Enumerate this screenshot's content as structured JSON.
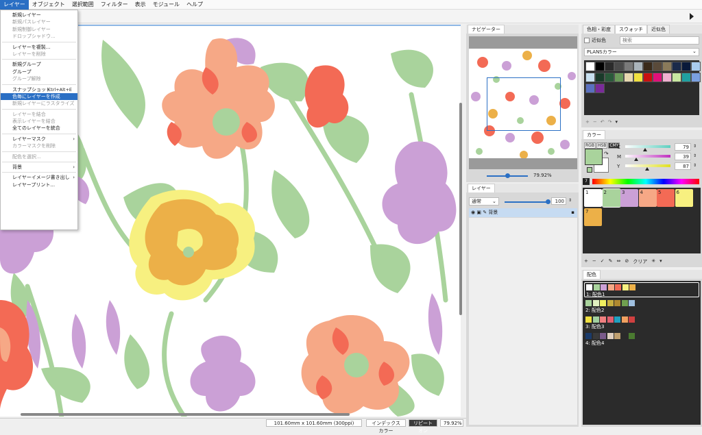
{
  "menubar": [
    "レイヤー",
    "オブジェクト",
    "選択範囲",
    "フィルター",
    "表示",
    "モジュール",
    "ヘルプ"
  ],
  "layer_menu": [
    {
      "label": "新規レイヤー",
      "dis": false
    },
    {
      "label": "新規パスレイヤー",
      "dis": true
    },
    {
      "label": "新規制御レイヤー",
      "dis": true
    },
    {
      "label": "ドロップシャドウ...",
      "dis": true
    },
    {
      "sep": true
    },
    {
      "label": "レイヤーを複製...",
      "dis": false
    },
    {
      "label": "レイヤーを削除",
      "dis": true
    },
    {
      "sep": true
    },
    {
      "label": "新規グループ",
      "dis": false
    },
    {
      "label": "グループ",
      "dis": false
    },
    {
      "label": "グループ解除",
      "dis": true
    },
    {
      "sep": true
    },
    {
      "label": "スナップショット",
      "dis": false,
      "shortcut": "Ctrl+Alt+E"
    },
    {
      "label": "色毎にレイヤーを作成",
      "dis": false,
      "hl": true
    },
    {
      "label": "新規レイヤーにラスタライズ",
      "dis": true
    },
    {
      "sep": true
    },
    {
      "label": "レイヤーを結合",
      "dis": true
    },
    {
      "label": "表示レイヤーを結合",
      "dis": true
    },
    {
      "label": "全てのレイヤーを統合",
      "dis": false
    },
    {
      "sep": true
    },
    {
      "label": "レイヤーマスク",
      "dis": false,
      "sub": true
    },
    {
      "label": "カラーマスクを削除",
      "dis": true
    },
    {
      "sep": true
    },
    {
      "label": "配色を選択...",
      "dis": true
    },
    {
      "sep": true
    },
    {
      "label": "背景",
      "dis": false,
      "sub": true
    },
    {
      "sep": true
    },
    {
      "label": "レイヤーイメージ書き出し",
      "dis": false,
      "sub": true
    },
    {
      "label": "レイヤープリント...",
      "dis": false
    }
  ],
  "status": {
    "size": "101.60mm x 101.60mm (300ppi)",
    "mode": "インデックスカラー",
    "repeat": "リピートオン",
    "zoom": "79.92%"
  },
  "navigator": {
    "title": "ナビゲーター",
    "zoom": "79.92%"
  },
  "layers": {
    "title": "レイヤー",
    "blend": "通常",
    "opacity": "100",
    "layer_name": "背景"
  },
  "swatch_panel": {
    "tabs": [
      "色相・彩度",
      "スウォッチ",
      "近似色"
    ],
    "approx_label": "近似色",
    "search_placeholder": "検索",
    "set": "PLANSカラー",
    "colors": [
      "#ffffff",
      "#000000",
      "#2b2b2b",
      "#4a4a4a",
      "#7a7a7a",
      "#aab4bb",
      "#3a2a1a",
      "#5a4a3a",
      "#8a7a5a",
      "#1a2a4a",
      "#0a1a3a",
      "#aaccee",
      "#c8e0f0",
      "#1a3a2a",
      "#2a5a3a",
      "#6a9a5a",
      "#e8d8b0",
      "#f0e040",
      "#c81010",
      "#e0107a",
      "#f0b0d0",
      "#c8e8a0",
      "#20a0a0",
      "#7aa0e0",
      "#5a70c0",
      "#7a2a9a"
    ]
  },
  "color_panel": {
    "title": "カラー",
    "modes": [
      "RGB",
      "HSB",
      "CMY"
    ],
    "channels": [
      {
        "name": "C",
        "value": "79"
      },
      {
        "name": "M",
        "value": "39"
      },
      {
        "name": "Y",
        "value": "87"
      }
    ],
    "count": "7",
    "clear": "クリア",
    "color_table": [
      {
        "n": "1",
        "c": "#ffffff"
      },
      {
        "n": "2",
        "c": "#a9d39c"
      },
      {
        "n": "3",
        "c": "#cba0d6"
      },
      {
        "n": "4",
        "c": "#f6a886"
      },
      {
        "n": "5",
        "c": "#f36a55"
      },
      {
        "n": "6",
        "c": "#f7f080"
      },
      {
        "n": "7",
        "c": "#ecb048"
      }
    ]
  },
  "scheme_panel": {
    "title": "配色",
    "schemes": [
      {
        "name": "1: 配色1",
        "colors": [
          "#ffffff",
          "#a9d39c",
          "#cba0d6",
          "#f6a886",
          "#f36a55",
          "#f7f080",
          "#ecb048"
        ]
      },
      {
        "name": "2: 配色2",
        "colors": [
          "#a9d39c",
          "#e0f0c0",
          "#f0f060",
          "#c8b040",
          "#b08a30",
          "#70a050",
          "#a0c0e0"
        ]
      },
      {
        "name": "3: 配色3",
        "colors": [
          "#f0e040",
          "#a0d0a0",
          "#f08080",
          "#e06070",
          "#20a0c0",
          "#f0a060",
          "#d04040"
        ]
      },
      {
        "name": "4: 配色4",
        "colors": [
          "#1a3a6a",
          "#3a3a3a",
          "#7a5a8a",
          "#e0d0c0",
          "#c0a070",
          "#2a2a2a",
          "#4a7a30"
        ]
      }
    ]
  }
}
